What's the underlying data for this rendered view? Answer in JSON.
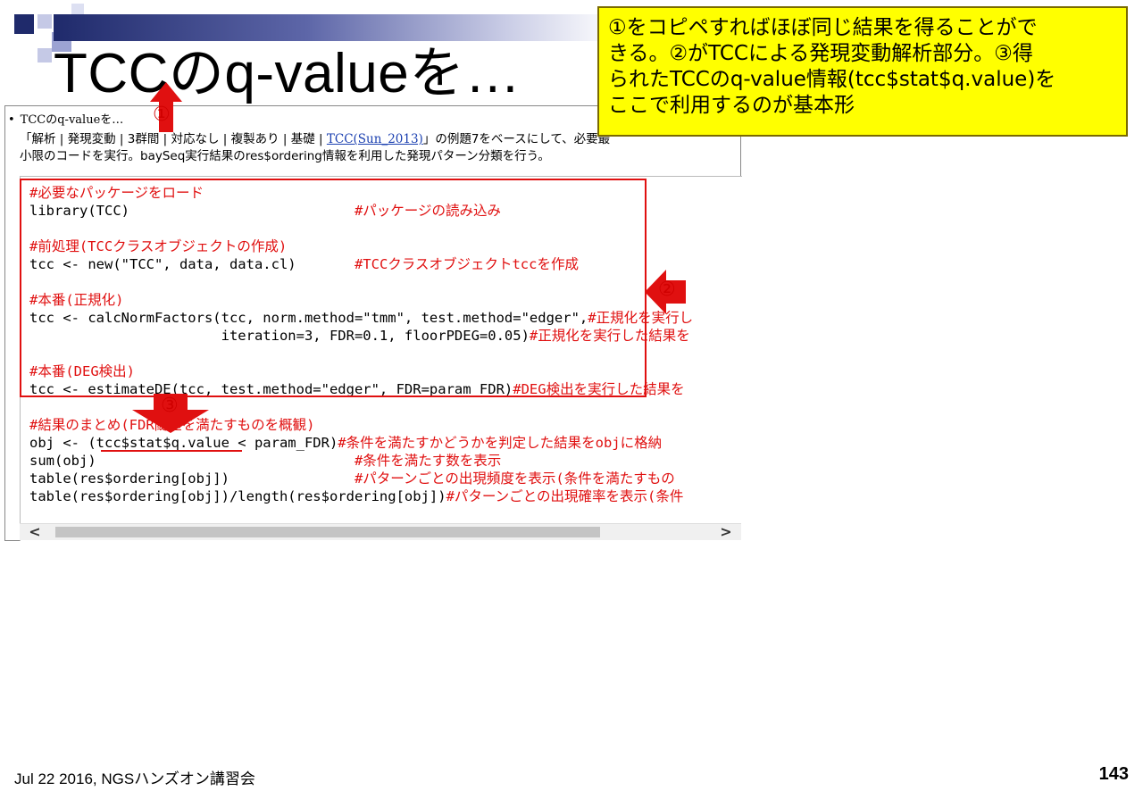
{
  "slide": {
    "title": "TCCのq-valueを…",
    "callout_lines": [
      "①をコピペすればほぼ同じ結果を得ることがで",
      "きる。②がTCCによる発現変動解析部分。③得",
      "られたTCCのq-value情報(tcc$stat$q.value)を",
      "ここで利用するのが基本形"
    ],
    "footer": "Jul 22 2016, NGSハンズオン講習会",
    "page_number": "143"
  },
  "webpage": {
    "bullet": "TCCのq-valueを…",
    "desc_line1_prefix": "「解析 | 発現変動 | 3群間 | 対応なし | 複製あり | 基礎 | ",
    "desc_link": "TCC(Sun_2013)",
    "desc_line1_suffix": "」の例題7をベースにして、必要最",
    "desc_line2": "小限のコードを実行。baySeq実行結果のres$ordering情報を利用した発現パターン分類を行う。",
    "code_lines": [
      {
        "code": "",
        "comment": "#必要なパッケージをロード"
      },
      {
        "code": "library(TCC)                           ",
        "comment": "#パッケージの読み込み"
      },
      {
        "code": "",
        "comment": ""
      },
      {
        "code": "",
        "comment": "#前処理(TCCクラスオブジェクトの作成)"
      },
      {
        "code": "tcc <- new(\"TCC\", data, data.cl)       ",
        "comment": "#TCCクラスオブジェクトtccを作成"
      },
      {
        "code": "",
        "comment": ""
      },
      {
        "code": "",
        "comment": "#本番(正規化)"
      },
      {
        "code": "tcc <- calcNormFactors(tcc, norm.method=\"tmm\", test.method=\"edger\",",
        "comment": "#正規化を実行し"
      },
      {
        "code": "                       iteration=3, FDR=0.1, floorPDEG=0.05)",
        "comment": "#正規化を実行した結果を"
      },
      {
        "code": "",
        "comment": ""
      },
      {
        "code": "",
        "comment": "#本番(DEG検出)"
      },
      {
        "code": "tcc <- estimateDE(tcc, test.method=\"edger\", FDR=param_FDR)",
        "comment": "#DEG検出を実行した結果を"
      },
      {
        "code": "",
        "comment": ""
      },
      {
        "code": "",
        "comment": "#結果のまとめ(FDR閾値を満たすものを概観)"
      },
      {
        "code": "obj <- (tcc$stat$q.value < param_FDR)",
        "comment": "#条件を満たすかどうかを判定した結果をobjに格納"
      },
      {
        "code": "sum(obj)                               ",
        "comment": "#条件を満たす数を表示"
      },
      {
        "code": "table(res$ordering[obj])               ",
        "comment": "#パターンごとの出現頻度を表示(条件を満たすもの"
      },
      {
        "code": "table(res$ordering[obj])/length(res$ordering[obj])",
        "comment": "#パターンごとの出現確率を表示(条件"
      }
    ],
    "scroll_left": "<",
    "scroll_right": ">"
  },
  "markers": {
    "m1": "①",
    "m2": "②",
    "m3": "③"
  },
  "colors": {
    "comment_red": "#e01010",
    "callout_yellow": "#ffff00",
    "link_blue": "#1a3fb0"
  }
}
